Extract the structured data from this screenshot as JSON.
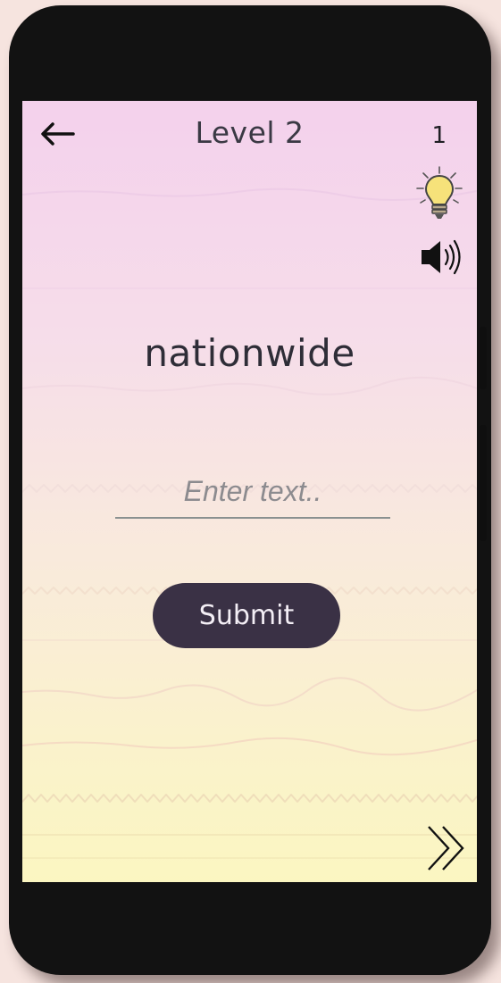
{
  "header": {
    "back_icon": "arrow-left-icon",
    "title": "Level 2",
    "score": "1"
  },
  "controls": {
    "hint_icon": "lightbulb-icon",
    "sound_icon": "speaker-icon"
  },
  "main": {
    "word": "nationwide",
    "input_placeholder": "Enter text..",
    "input_value": "",
    "submit_label": "Submit"
  },
  "footer": {
    "next_icon": "double-chevron-right-icon"
  },
  "colors": {
    "screen_top": "#f4d1ec",
    "screen_bottom": "#fbf6c1",
    "submit_background": "#3a3145",
    "text_dark": "#2e2d37",
    "input_underline": "#8a9190"
  }
}
